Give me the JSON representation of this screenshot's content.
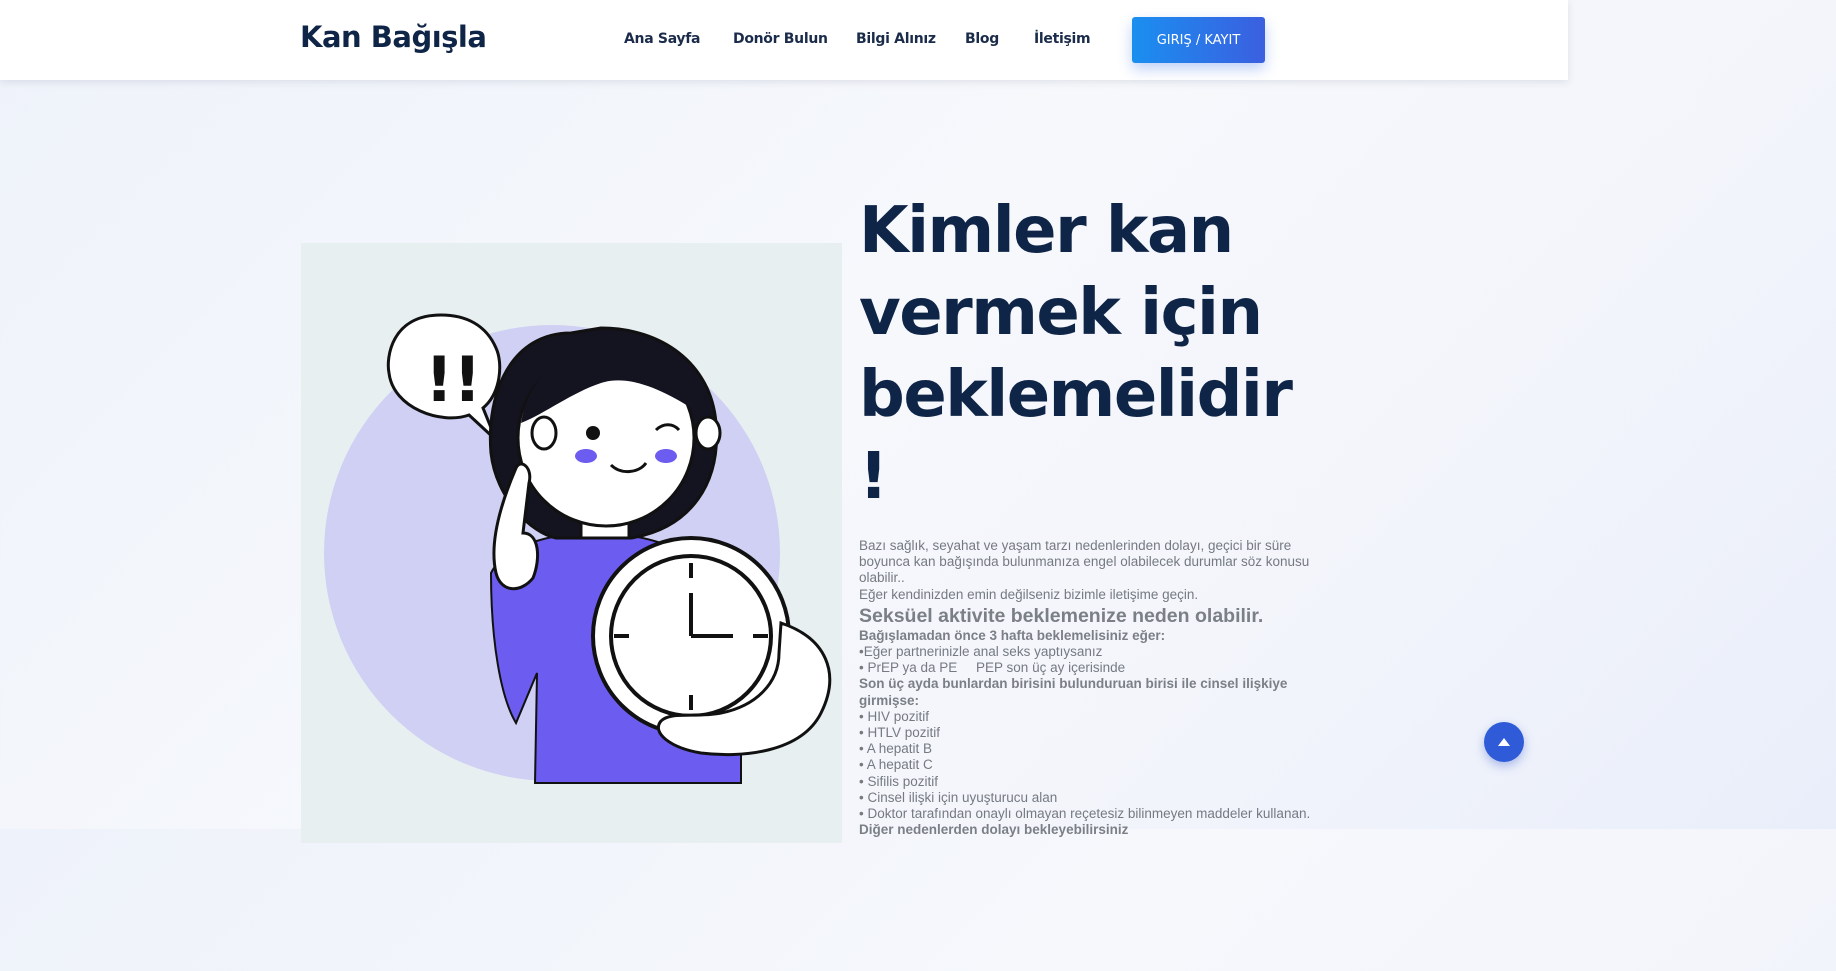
{
  "header": {
    "logo": "Kan Bağışla",
    "nav": [
      "Ana Sayfa",
      "Donör Bulun",
      "Bilgi Alınız",
      "Blog",
      "İletişim"
    ],
    "login_label": "GIRIŞ / KAYIT"
  },
  "hero": {
    "title_lines": [
      "Kimler kan",
      "vermek için",
      "beklemelidir",
      "!"
    ],
    "intro": "Bazı sağlık, seyahat ve yaşam tarzı nedenlerinden dolayı, geçici bir süre boyunca kan bağışında bulunmanıza engel olabilecek durumlar söz konusu olabilir..",
    "contact_line": "Eğer kendinizden emin değilseniz bizimle iletişime geçin.",
    "section_title": "Seksüel aktivite beklemenize neden olabilir.",
    "wait_heading": "Bağışlamadan önce 3 hafta beklemelisiniz eğer:",
    "wait_items": [
      "•Eğer partnerinizle anal seks yaptıysanız",
      "• PrEP ya da PE     PEP son üç ay içerisinde"
    ],
    "partner_heading": "Son üç ayda bunlardan birisini bulunduruan birisi ile cinsel ilişkiye girmişse:",
    "partner_items": [
      "• HIV pozitif",
      "• HTLV pozitif",
      "• A hepatit B",
      "• A hepatit C",
      "• Sifilis pozitif",
      "• Cinsel ilişki için uyuşturucu alan",
      "• Doktor tarafından onaylı olmayan reçetesiz bilinmeyen maddeler kullanan."
    ],
    "next_heading": "Diğer nedenlerden dolayı bekleyebilirsiniz"
  },
  "illustration": {
    "speech_text": "!!"
  },
  "colors": {
    "primary_dark": "#0f2547",
    "accent_blue": "#2f5bd8",
    "illus_purple": "#6c5cf0",
    "illus_lavender": "#cfd0f3"
  }
}
